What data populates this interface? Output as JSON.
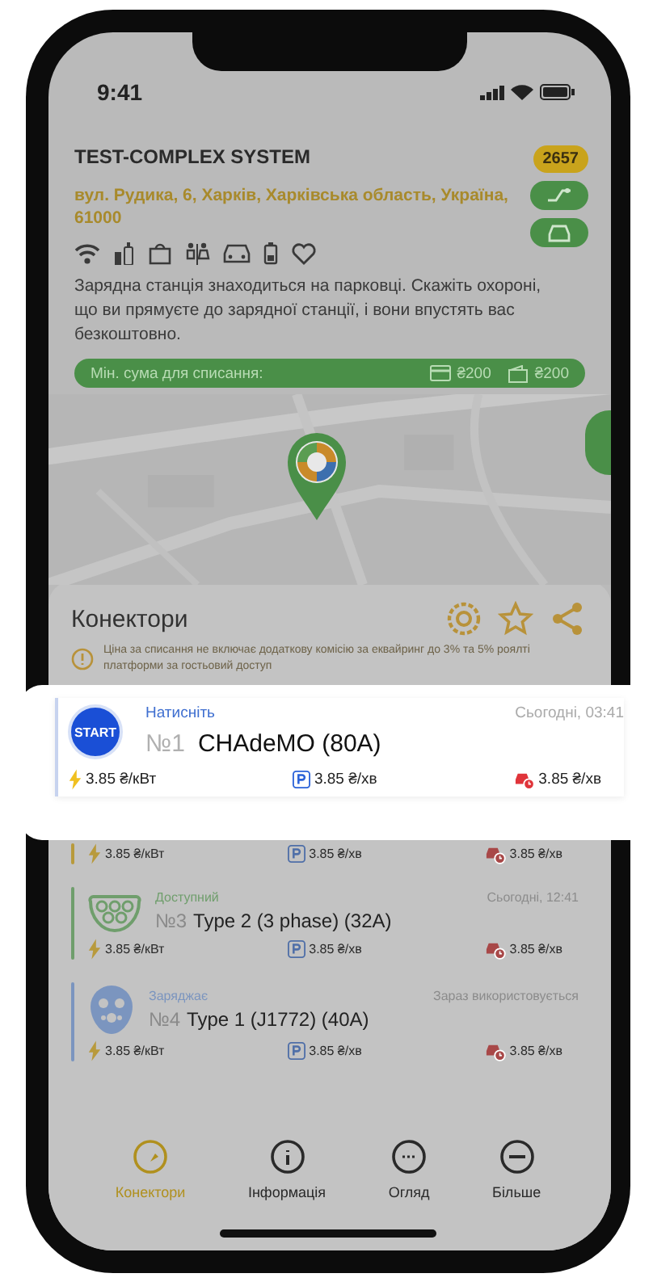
{
  "status_bar": {
    "time": "9:41"
  },
  "station": {
    "title": "TEST-COMPLEX SYSTEM",
    "badge": "2657",
    "address": "вул. Рудика, 6, Харків, Харківська область, Україна, 61000",
    "description": "Зарядна станція знаходиться на парковці. Скажіть охороні, що ви прямуєте до зарядної станції, і вони впустять вас безкоштовно.",
    "min_charge": {
      "label": "Мін. сума для списання:",
      "card_amount": "₴200",
      "wallet_amount": "₴200"
    }
  },
  "connectors_section": {
    "title": "Конектори",
    "note": "Ціна за списання не включає додаткову комісію за еквайринг до 3% та 5% роялті платформи за гостьовий доступ"
  },
  "highlighted_connector": {
    "button": "START",
    "status": "Натисніть",
    "time": "Сьогодні, 03:41",
    "number": "№1",
    "name": "CHAdeMO (80A)",
    "energy_price": "3.85 ₴/кВт",
    "parking_price": "3.85 ₴/хв",
    "idle_price": "3.85 ₴/хв"
  },
  "connectors": [
    {
      "kind": "partial",
      "color": "#b89a3c",
      "energy_price": "3.85 ₴/кВт",
      "parking_price": "3.85 ₴/хв",
      "idle_price": "3.85 ₴/хв"
    },
    {
      "kind": "type2",
      "color": "#6f9e6c",
      "status": "Доступний",
      "time": "Сьогодні, 12:41",
      "number": "№3",
      "name": "Type 2 (3 phase) (32A)",
      "energy_price": "3.85 ₴/кВт",
      "parking_price": "3.85 ₴/хв",
      "idle_price": "3.85 ₴/хв"
    },
    {
      "kind": "type1",
      "color": "#7b95bf",
      "status": "Заряджає",
      "time": "Зараз використовується",
      "number": "№4",
      "name": "Type 1 (J1772) (40A)",
      "energy_price": "3.85 ₴/кВт",
      "parking_price": "3.85 ₴/хв",
      "idle_price": "3.85 ₴/хв"
    }
  ],
  "tabs": [
    {
      "label": "Конектори",
      "selected": true
    },
    {
      "label": "Інформація",
      "selected": false
    },
    {
      "label": "Огляд",
      "selected": false
    },
    {
      "label": "Більше",
      "selected": false
    }
  ]
}
